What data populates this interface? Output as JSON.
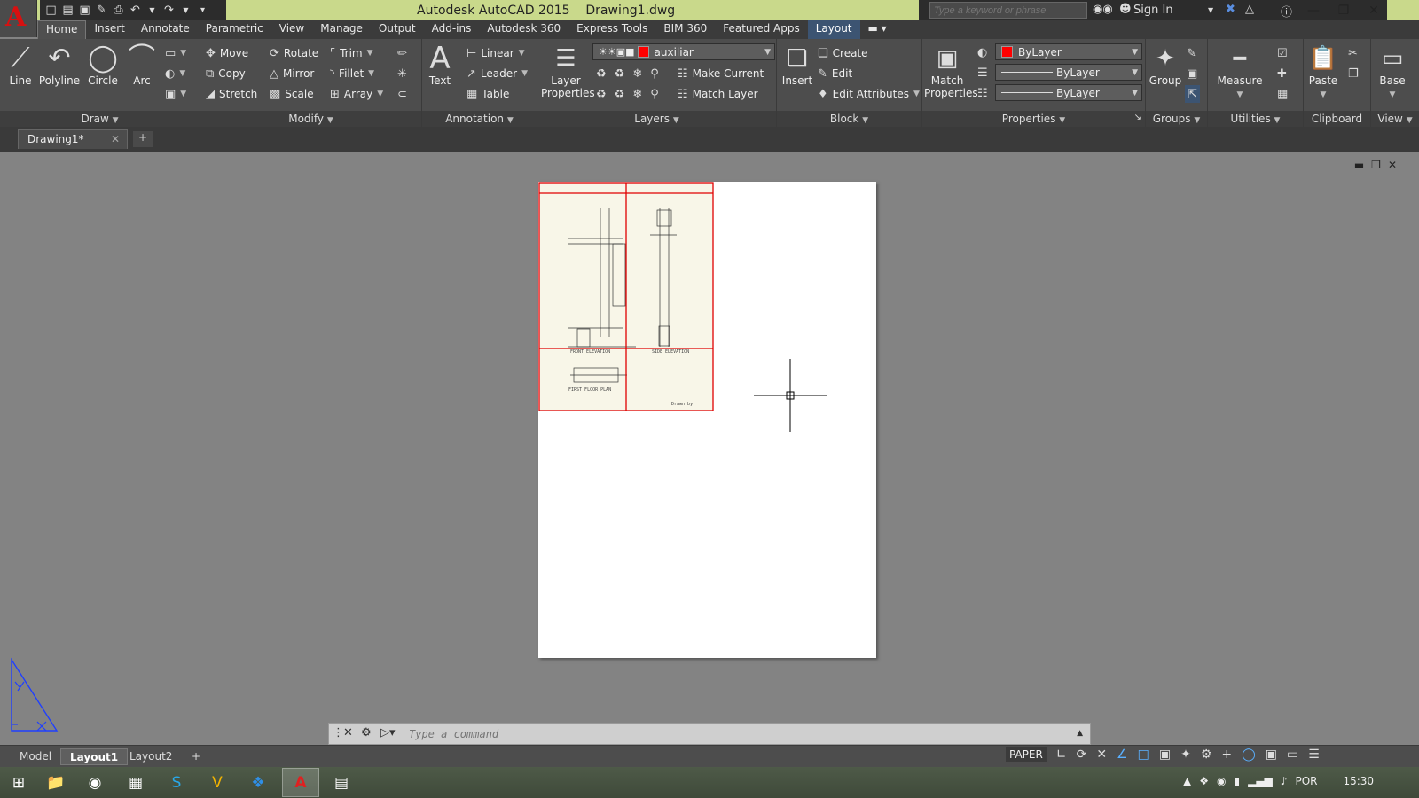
{
  "titlebar": {
    "app_title": "Autodesk AutoCAD 2015",
    "doc_title": "Drawing1.dwg",
    "search_placeholder": "Type a keyword or phrase",
    "signin": "Sign In"
  },
  "ribbon_tabs": [
    "Home",
    "Insert",
    "Annotate",
    "Parametric",
    "View",
    "Manage",
    "Output",
    "Add-ins",
    "Autodesk 360",
    "Express Tools",
    "BIM 360",
    "Featured Apps",
    "Layout"
  ],
  "active_tab": "Home",
  "draw": {
    "line": "Line",
    "polyline": "Polyline",
    "circle": "Circle",
    "arc": "Arc",
    "title": "Draw"
  },
  "modify": {
    "move": "Move",
    "rotate": "Rotate",
    "trim": "Trim",
    "copy": "Copy",
    "mirror": "Mirror",
    "fillet": "Fillet",
    "stretch": "Stretch",
    "scale": "Scale",
    "array": "Array",
    "title": "Modify"
  },
  "annotation": {
    "text": "Text",
    "linear": "Linear",
    "leader": "Leader",
    "table": "Table",
    "title": "Annotation"
  },
  "layers": {
    "layer_properties_1": "Layer",
    "layer_properties_2": "Properties",
    "current_layer": "auxiliar",
    "layer_color": "#ff0000",
    "make_current": "Make Current",
    "match_layer": "Match Layer",
    "title": "Layers"
  },
  "block": {
    "insert": "Insert",
    "create": "Create",
    "edit": "Edit",
    "edit_attributes": "Edit Attributes",
    "title": "Block"
  },
  "properties": {
    "match_1": "Match",
    "match_2": "Properties",
    "color": "ByLayer",
    "lineweight": "ByLayer",
    "linetype": "ByLayer",
    "title": "Properties"
  },
  "groups": {
    "group": "Group",
    "title": "Groups"
  },
  "utilities": {
    "measure": "Measure",
    "title": "Utilities"
  },
  "clipboard": {
    "paste": "Paste",
    "title": "Clipboard"
  },
  "view": {
    "base": "Base",
    "title": "View"
  },
  "doc_tab": "Drawing1*",
  "command": {
    "placeholder": "Type a command"
  },
  "layout_tabs": [
    "Model",
    "Layout1",
    "Layout2"
  ],
  "active_layout": "Layout1",
  "status": {
    "paper": "PAPER"
  },
  "tray": {
    "lang": "POR",
    "time": "15:30"
  },
  "sheet": {
    "label_left_1": "FRONT ELEVATION",
    "label_right_1": "SIDE ELEVATION",
    "label_left_2": "FIRST FLOOR PLAN",
    "signature": "Drawn by"
  }
}
